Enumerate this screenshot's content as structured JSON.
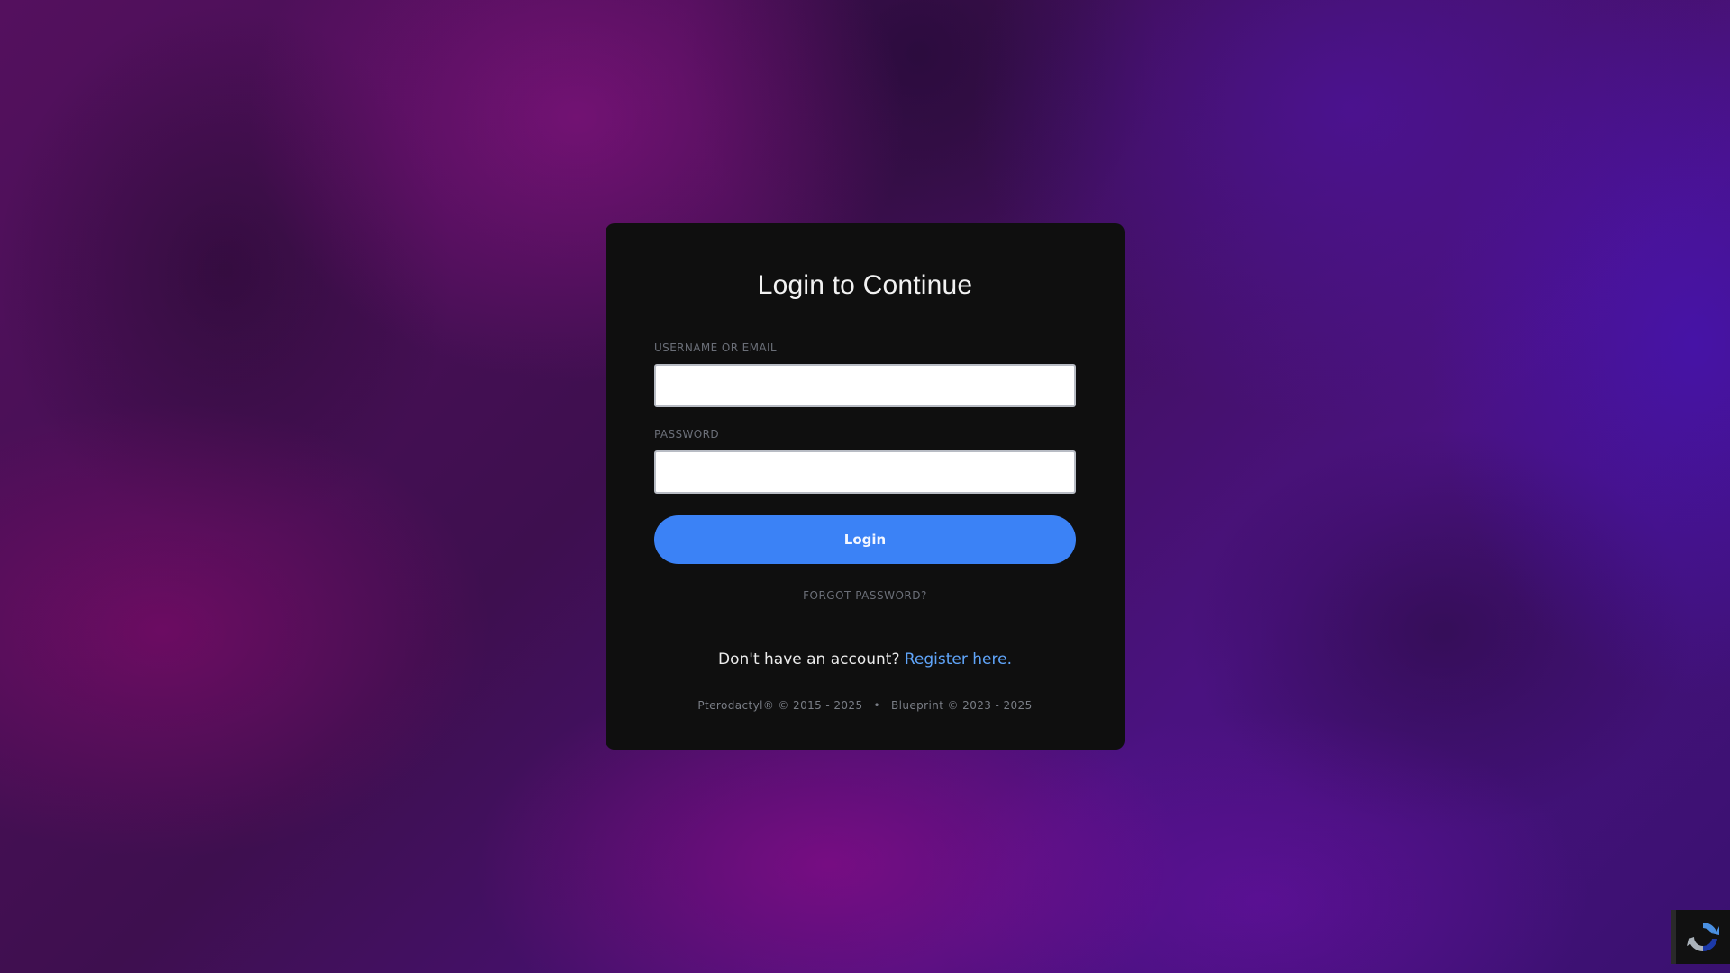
{
  "login": {
    "title": "Login to Continue",
    "username_label": "USERNAME OR EMAIL",
    "username_value": "",
    "password_label": "PASSWORD",
    "password_value": "",
    "button_label": "Login",
    "forgot_password": "FORGOT PASSWORD?",
    "register_prompt": "Don't have an account?",
    "register_link": "Register here."
  },
  "footer": {
    "pterodactyl": "Pterodactyl® © 2015 - 2025",
    "separator": "•",
    "blueprint": "Blueprint © 2023 - 2025"
  },
  "colors": {
    "accent": "#3b82f6",
    "link": "#60a5fa",
    "card": "#0f0f0f"
  },
  "icons": {
    "recaptcha": "recaptcha-icon"
  }
}
